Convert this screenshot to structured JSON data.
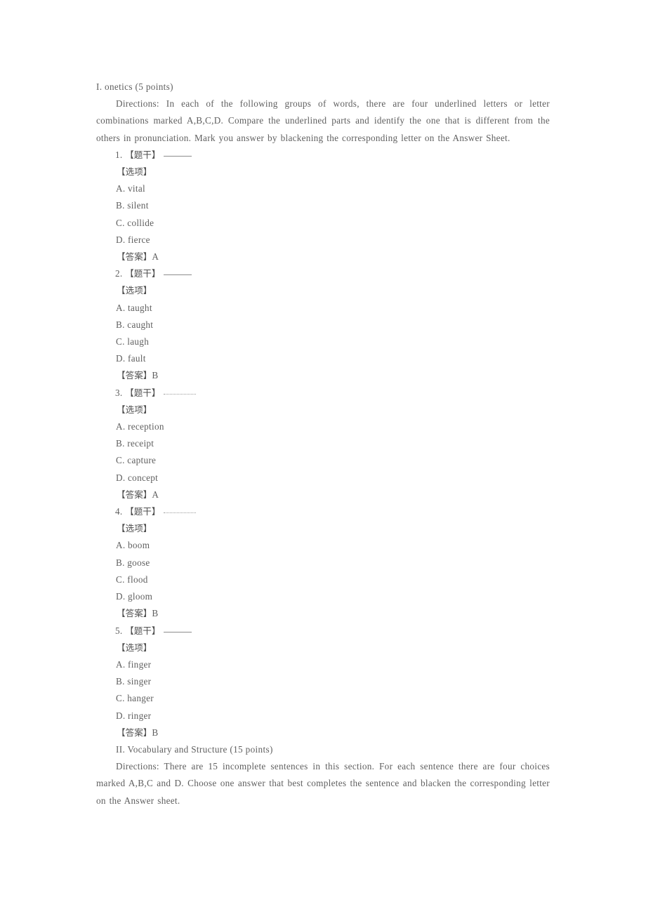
{
  "page": {
    "background": "#ffffff",
    "text_color": "#5f5f5f",
    "blank_color": "#8d8d8d"
  },
  "sections": [
    {
      "heading": "I. onetics (5 points)",
      "directions": "Directions: In each of the following groups of words, there are four underlined letters or letter combinations marked A,B,C,D. Compare the underlined parts and identify the one that is different from the others in pronunciation. Mark you answer by blackening the corresponding letter on the Answer Sheet."
    },
    {
      "heading": "II. Vocabulary and Structure (15 points)",
      "directions": "Directions: There are 15 incomplete sentences in this section. For each sentence there are four choices marked A,B,C and D. Choose one answer that best completes the sentence and blacken the corresponding letter on the Answer sheet."
    }
  ],
  "labels": {
    "stem": "【题干】",
    "options": "【选项】",
    "answer": "【答案】"
  },
  "questions": [
    {
      "number": "1.",
      "blank_style": "solid",
      "choices": [
        "A. vital",
        "B. silent",
        "C. collide",
        "D. fierce"
      ],
      "answer": "A"
    },
    {
      "number": "2.",
      "blank_style": "solid",
      "choices": [
        "A. taught",
        "B. caught",
        "C. laugh",
        "D. fault"
      ],
      "answer": "B"
    },
    {
      "number": "3.",
      "blank_style": "dotted",
      "choices": [
        "A. reception",
        "B. receipt",
        "C. capture",
        "D. concept"
      ],
      "answer": "A"
    },
    {
      "number": "4.",
      "blank_style": "dotted",
      "choices": [
        "A. boom",
        "B. goose",
        "C. flood",
        "D. gloom"
      ],
      "answer": "B"
    },
    {
      "number": "5.",
      "blank_style": "solid",
      "choices": [
        "A. finger",
        "B. singer",
        "C. hanger",
        "D. ringer"
      ],
      "answer": "B"
    }
  ]
}
